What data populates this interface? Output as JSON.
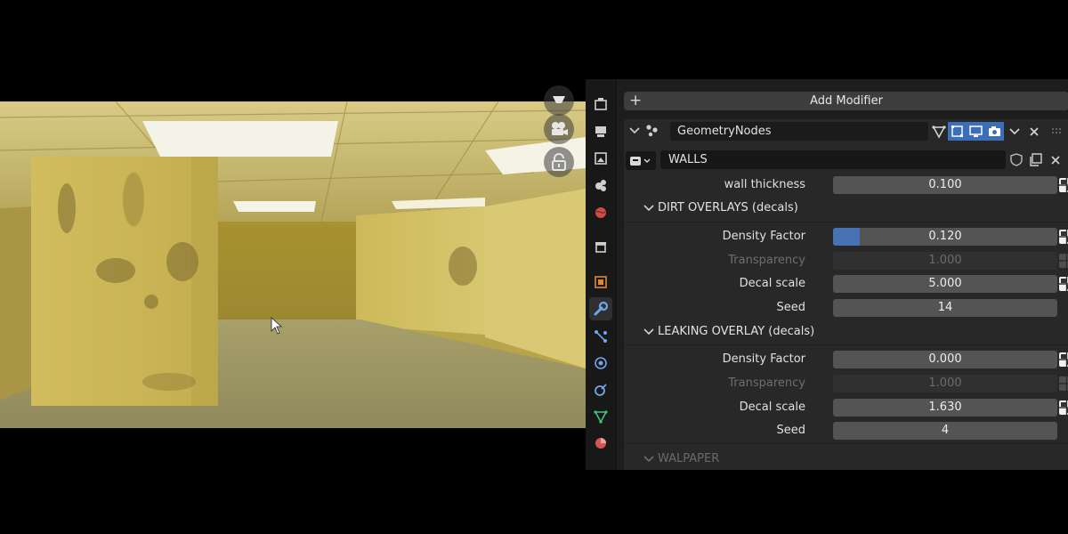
{
  "toolbar": {
    "add_modifier_label": "Add Modifier"
  },
  "modifier": {
    "name": "GeometryNodes",
    "node_group": "WALLS",
    "top_row": {
      "label": "wall thickness",
      "value": "0.100"
    },
    "panels": [
      {
        "title": "DIRT OVERLAYS (decals)",
        "rows": [
          {
            "label": "Density Factor",
            "value": "0.120",
            "fill_fraction": 0.12,
            "disabled": false
          },
          {
            "label": "Transparency",
            "value": "1.000",
            "disabled": true
          },
          {
            "label": "Decal scale",
            "value": "5.000",
            "disabled": false
          },
          {
            "label": "Seed",
            "value": "14",
            "disabled": false
          }
        ]
      },
      {
        "title": "LEAKING OVERLAY (decals)",
        "rows": [
          {
            "label": "Density Factor",
            "value": "0.000",
            "disabled": false
          },
          {
            "label": "Transparency",
            "value": "1.000",
            "disabled": true
          },
          {
            "label": "Decal scale",
            "value": "1.630",
            "disabled": false
          },
          {
            "label": "Seed",
            "value": "4",
            "disabled": false
          }
        ]
      },
      {
        "title": "WALPAPER",
        "collapsed": true
      }
    ]
  },
  "colors": {
    "accent": "#4772b3",
    "panel_bg": "#282828",
    "field_bg": "#545454",
    "scene_wall": "#c4b15a"
  },
  "icons": [
    "camera-icon",
    "lock-icon",
    "wrench-icon",
    "geometry-nodes-icon",
    "close-icon",
    "shield-icon",
    "copy-icon"
  ]
}
